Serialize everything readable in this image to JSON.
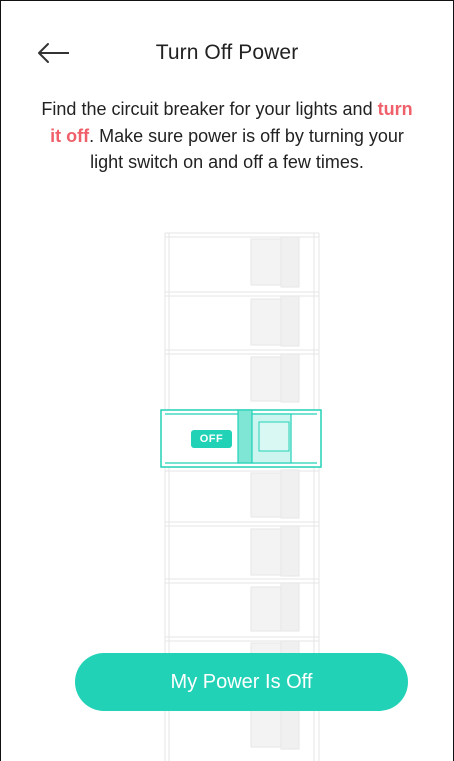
{
  "header": {
    "title": "Turn Off Power",
    "back_icon": "arrow-left-icon"
  },
  "instructions": {
    "part1": "Find the circuit breaker for your lights and ",
    "highlight": "turn it off",
    "part2": ". Make sure power is off by turning your light switch on and off a few times."
  },
  "breaker": {
    "off_label": "OFF"
  },
  "primary_button": {
    "label": "My Power Is Off"
  },
  "colors": {
    "accent": "#22d2b7",
    "highlight": "#f0606a",
    "breaker_outline": "#e6e6e6"
  }
}
